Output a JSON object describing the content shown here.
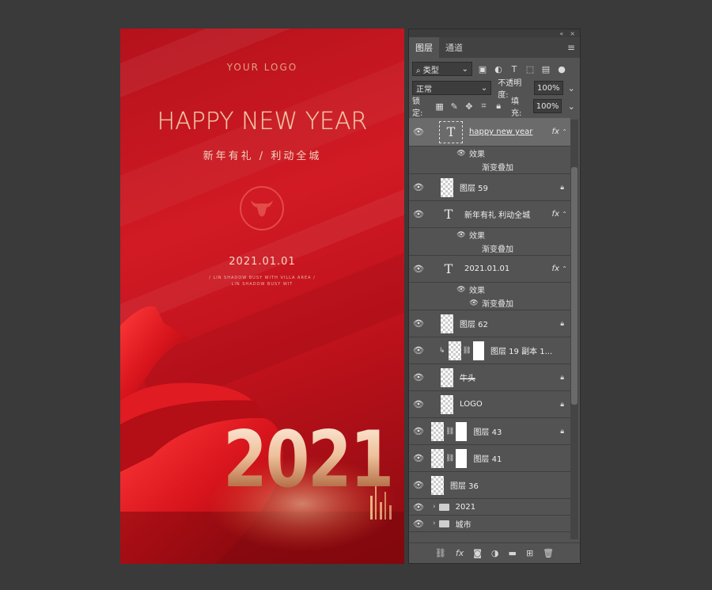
{
  "poster": {
    "logo": "YOUR LOGO",
    "headline": "HAPPY NEW YEAR",
    "subtitle": "新年有礼 / 利动全城",
    "date": "2021.01.01",
    "tagline_1": "/ LIN SHADOW BUSY WITH VILLA AREA /",
    "tagline_2": "LIN SHADOW BUSY WIT",
    "year": "2021"
  },
  "panel": {
    "window_controls": [
      "«",
      "×"
    ],
    "tabs": [
      {
        "label": "图层",
        "active": true
      },
      {
        "label": "通道",
        "active": false
      }
    ],
    "menu_icon": "≡",
    "filter_type": "类型",
    "filter_icons": [
      "image-filter-icon",
      "adjustment-filter-icon",
      "text-filter-icon",
      "shape-filter-icon",
      "smartobject-filter-icon"
    ],
    "blend_mode": "正常",
    "opacity_label": "不透明度:",
    "opacity_value": "100%",
    "lock_label": "锁定:",
    "fill_label": "填充:",
    "fill_value": "100%",
    "effects_label": "效果",
    "gradient_overlay_label": "渐变叠加",
    "layers": {
      "happy": "happy new year",
      "l59": "图层 59",
      "slogan": "新年有礼  利动全城",
      "date": "2021.01.01",
      "l62": "图层 62",
      "l19": "图层 19 副本 1...",
      "ox": "牛头",
      "logo": "LOGO",
      "l43": "图层 43",
      "l41": "图层 41",
      "l36": "图层 36",
      "g2021": "2021",
      "gcity": "城市"
    },
    "bottom_icons": [
      "link-icon",
      "fx-icon",
      "mask-icon",
      "adjustment-icon",
      "folder-icon",
      "new-layer-icon",
      "trash-icon"
    ]
  }
}
